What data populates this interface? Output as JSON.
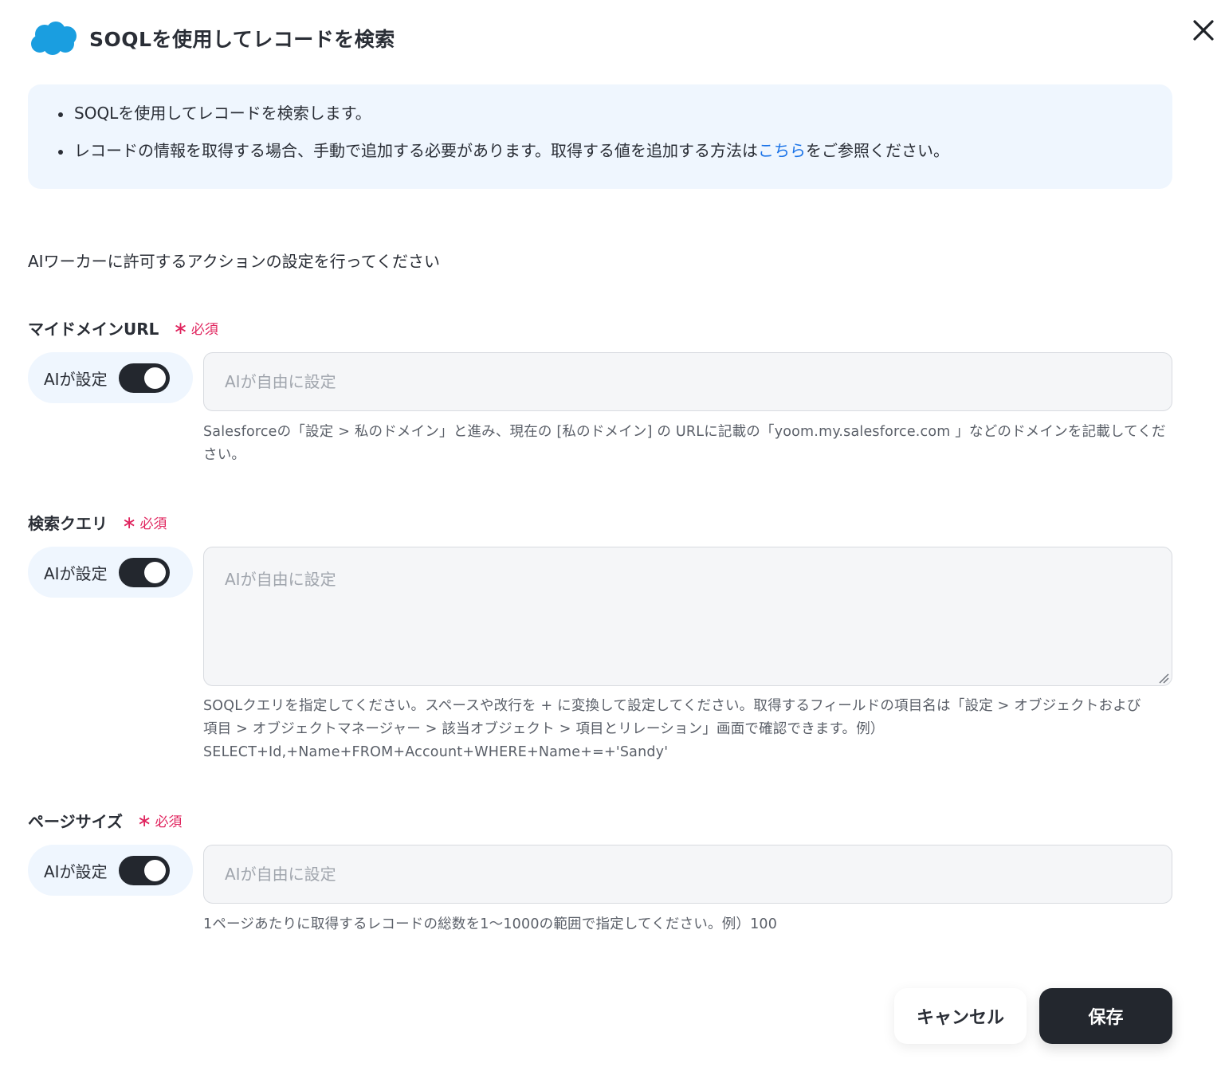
{
  "header": {
    "title": "SOQLを使用してレコードを検索",
    "logo_icon": "salesforce-cloud-icon",
    "close_icon": "close-icon"
  },
  "info": {
    "items": [
      {
        "text": "SOQLを使用してレコードを検索します。"
      },
      {
        "before": "レコードの情報を取得する場合、手動で追加する必要があります。取得する値を追加する方法は",
        "link": "こちら",
        "after": "をご参照ください。"
      }
    ]
  },
  "section_lead": "AIワーカーに許可するアクションの設定を行ってください",
  "fields": [
    {
      "label": "マイドメインURL",
      "required": "必須",
      "toggle_label": "AIが設定",
      "toggle_on": true,
      "placeholder": "AIが自由に設定",
      "help": "Salesforceの「設定 > 私のドメイン」と進み、現在の [私のドメイン] の URLに記載の「yoom.my.salesforce.com 」などのドメインを記載してください。"
    },
    {
      "label": "検索クエリ",
      "required": "必須",
      "toggle_label": "AIが設定",
      "toggle_on": true,
      "placeholder": "AIが自由に設定",
      "help_lines": [
        "SOQLクエリを指定してください。スペースや改行を + に変換して設定してください。取得するフィールドの項目名は「設定 > オブジェクトおよび",
        "項目 > オブジェクトマネージャー > 該当オブジェクト > 項目とリレーション」画面で確認できます。例）",
        "SELECT+Id,+Name+FROM+Account+WHERE+Name+=+'Sandy'"
      ]
    },
    {
      "label": "ページサイズ",
      "required": "必須",
      "toggle_label": "AIが設定",
      "toggle_on": true,
      "placeholder": "AIが自由に設定",
      "help": "1ページあたりに取得するレコードの総数を1〜1000の範囲で指定してください。例）100"
    }
  ],
  "footer": {
    "cancel_label": "キャンセル",
    "save_label": "保存"
  },
  "colors": {
    "accent_dark": "#23272e",
    "required_red": "#e0245e",
    "link_blue": "#1a73e8",
    "info_bg": "#eff6fe",
    "salesforce_blue": "#1a9ee0"
  }
}
